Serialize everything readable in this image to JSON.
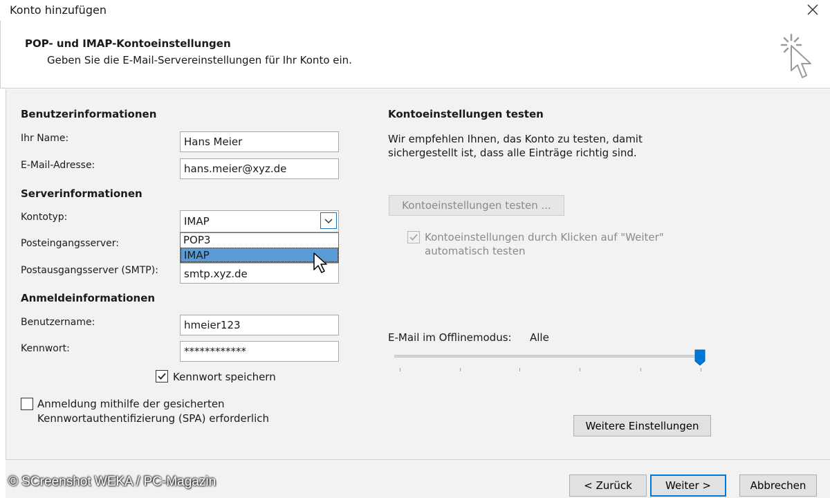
{
  "window": {
    "title": "Konto hinzufügen"
  },
  "header": {
    "title": "POP- und IMAP-Kontoeinstellungen",
    "subtitle": "Geben Sie die E-Mail-Servereinstellungen für Ihr Konto ein."
  },
  "user_info": {
    "heading": "Benutzerinformationen",
    "name_label": "Ihr Name:",
    "name_value": "Hans Meier",
    "email_label": "E-Mail-Adresse:",
    "email_value": "hans.meier@xyz.de"
  },
  "server_info": {
    "heading": "Serverinformationen",
    "account_type_label": "Kontotyp:",
    "account_type_value": "IMAP",
    "account_type_options": [
      "POP3",
      "IMAP"
    ],
    "account_type_highlighted": "IMAP",
    "incoming_label": "Posteingangsserver:",
    "outgoing_label": "Postausgangsserver (SMTP):",
    "outgoing_value": "smtp.xyz.de"
  },
  "login_info": {
    "heading": "Anmeldeinformationen",
    "username_label": "Benutzername:",
    "username_value": "hmeier123",
    "password_label": "Kennwort:",
    "password_value": "************",
    "remember_label": "Kennwort speichern",
    "remember_checked": true,
    "spa_label_line1": "Anmeldung mithilfe der gesicherten",
    "spa_label_line2": "Kennwortauthentifizierung (SPA) erforderlich",
    "spa_checked": false
  },
  "test_settings": {
    "heading": "Kontoeinstellungen testen",
    "desc_line1": "Wir empfehlen Ihnen, das Konto zu testen, damit",
    "desc_line2": "sichergestellt ist, dass alle Einträge richtig sind.",
    "test_button": "Kontoeinstellungen testen ...",
    "auto_test_line1": "Kontoeinstellungen durch Klicken auf \"Weiter\"",
    "auto_test_line2": "automatisch testen",
    "auto_test_checked": true
  },
  "offline": {
    "label": "E-Mail im Offlinemodus:",
    "value": "Alle",
    "slider_level": 1.0
  },
  "buttons": {
    "more_settings": "Weitere Einstellungen",
    "back": "< Zurück",
    "next": "Weiter >",
    "cancel": "Abbrechen"
  },
  "watermark": "© SCreenshot WEKA / PC-Magazin",
  "colors": {
    "accent": "#0078d7",
    "selection": "#5b9bd5",
    "panel": "#f2f2f2"
  }
}
